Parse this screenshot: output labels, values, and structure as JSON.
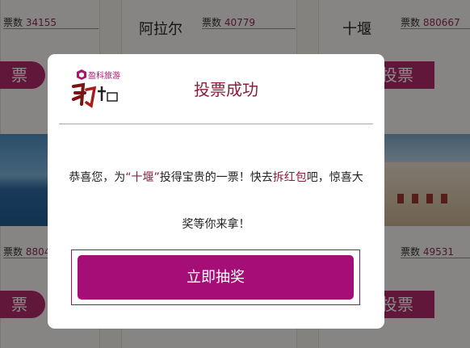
{
  "background": {
    "vote_label": "票数",
    "cards": [
      {
        "name": "",
        "votes": "34155"
      },
      {
        "name": "阿拉尔",
        "votes": "40779"
      },
      {
        "name": "十堰",
        "votes": "880667"
      },
      {
        "name": "",
        "votes": "8804"
      },
      {
        "name": "",
        "votes": ""
      },
      {
        "name": "",
        "votes": "49531"
      }
    ],
    "vote_button_left": "票",
    "vote_button_right": "投票"
  },
  "modal": {
    "logo_brand": "盈科旅游",
    "logo_text": "魅力中国城",
    "title": "投票成功",
    "message_prefix": "恭喜您，为",
    "message_city": "“十堰”",
    "message_mid": "投得宝贵的一票！快去",
    "message_link": "拆红包",
    "message_suffix": "吧，惊喜大奖等你来拿！",
    "button_label": "立即抽奖"
  },
  "colors": {
    "accent": "#a50e76",
    "title": "#8a1d3e",
    "vote_button": "#b12b6a"
  }
}
